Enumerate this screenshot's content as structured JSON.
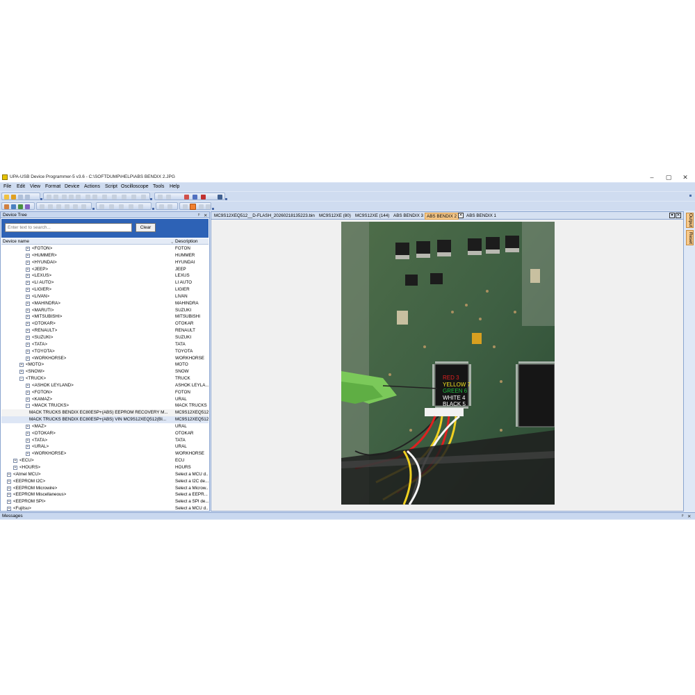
{
  "window": {
    "title": "UPA-USB Device Programmer-5 v3.6 - C:\\SOFTDUMP\\HELP\\ABS BENDIX 2.JPG",
    "minimize": "–",
    "maximize": "▢",
    "close": "✕"
  },
  "menu": [
    "File",
    "Edit",
    "View",
    "Format",
    "Device",
    "Actions",
    "Script",
    "Oscilloscope",
    "Tools",
    "Help"
  ],
  "device_tree": {
    "title": "Device Tree",
    "pin": "ᵖ",
    "close": "✕",
    "search_placeholder": "Enter text to search...",
    "clear_label": "Clear",
    "col_name": "Device name",
    "col_desc": "Description",
    "rows": [
      {
        "name": "<FOTON>",
        "desc": "FOTON",
        "indent": 3
      },
      {
        "name": "<HUMMER>",
        "desc": "HUMMER",
        "indent": 3
      },
      {
        "name": "<HYUNDAI>",
        "desc": "HYUNDAI",
        "indent": 3
      },
      {
        "name": "<JEEP>",
        "desc": "JEEP",
        "indent": 3
      },
      {
        "name": "<LEXUS>",
        "desc": "LEXUS",
        "indent": 3
      },
      {
        "name": "<LI AUTO>",
        "desc": "LI AUTO",
        "indent": 3
      },
      {
        "name": "<LIGIER>",
        "desc": "LIGIER",
        "indent": 3
      },
      {
        "name": "<LIVAN>",
        "desc": "LIVAN",
        "indent": 3
      },
      {
        "name": "<MAHINDRA>",
        "desc": "MAHINDRA",
        "indent": 3
      },
      {
        "name": "<MARUTI>",
        "desc": "SUZUKI",
        "indent": 3
      },
      {
        "name": "<MITSUBISHI>",
        "desc": "MITSUBISHI",
        "indent": 3
      },
      {
        "name": "<OTOKAR>",
        "desc": "OTOKAR",
        "indent": 3
      },
      {
        "name": "<RENAULT>",
        "desc": "RENAULT",
        "indent": 3
      },
      {
        "name": "<SUZUKI>",
        "desc": "SUZUKI",
        "indent": 3
      },
      {
        "name": "<TATA>",
        "desc": "TATA",
        "indent": 3
      },
      {
        "name": "<TOYOTA>",
        "desc": "TOYOTA",
        "indent": 3
      },
      {
        "name": "<WORKHORSE>",
        "desc": "WORKHORSE",
        "indent": 3
      },
      {
        "name": "<MOTO>",
        "desc": "MOTO",
        "indent": 2
      },
      {
        "name": "<SNOW>",
        "desc": "SNOW",
        "indent": 2
      },
      {
        "name": "<TRUCK>",
        "desc": "TRUCK",
        "indent": 2,
        "expanded": true
      },
      {
        "name": "<ASHOK LEYLAND>",
        "desc": "ASHOK LEYLA...",
        "indent": 3
      },
      {
        "name": "<FOTON>",
        "desc": "FOTON",
        "indent": 3
      },
      {
        "name": "<KAMAZ>",
        "desc": "URAL",
        "indent": 3
      },
      {
        "name": "<MACK TRUCKS>",
        "desc": "MACK TRUCKS",
        "indent": 3,
        "expanded": true
      },
      {
        "name": "MACK TRUCKS BENDIX EC80ESP+(ABS) EEPROM RECOVERY M...",
        "desc": "MC9S12XEQ512",
        "indent": 4,
        "leaf": true,
        "sel": 1
      },
      {
        "name": "MACK TRUCKS BENDIX EC80ESP+(ABS) VIN MC9S12XEQ512(BI...",
        "desc": "MC9S12XEQ512",
        "indent": 4,
        "leaf": true,
        "sel": 2
      },
      {
        "name": "<MAZ>",
        "desc": "URAL",
        "indent": 3
      },
      {
        "name": "<OTOKAR>",
        "desc": "OTOKAR",
        "indent": 3
      },
      {
        "name": "<TATA>",
        "desc": "TATA",
        "indent": 3
      },
      {
        "name": "<URAL>",
        "desc": "URAL",
        "indent": 3
      },
      {
        "name": "<WORKHORSE>",
        "desc": "WORKHORSE",
        "indent": 3
      },
      {
        "name": "<ECU>",
        "desc": "ECU",
        "indent": 1
      },
      {
        "name": "<HOURS>",
        "desc": "HOURS",
        "indent": 1
      },
      {
        "name": "<Atmel MCU>",
        "desc": "Select a MCU d...",
        "indent": 0
      },
      {
        "name": "<EEPROM I2C>",
        "desc": "Select a I2C de...",
        "indent": 0
      },
      {
        "name": "<EEPROM Microwire>",
        "desc": "Select a Microw...",
        "indent": 0
      },
      {
        "name": "<EEPROM Miscellaneous>",
        "desc": "Select a EEPR...",
        "indent": 0
      },
      {
        "name": "<EEPROM SPI>",
        "desc": "Select a SPI de...",
        "indent": 0
      },
      {
        "name": "<Fujitsu>",
        "desc": "Select a MCU d...",
        "indent": 0
      }
    ]
  },
  "tabs": [
    {
      "label": "MC9S12XEQ512__D-FLASH_20260218135223.bin",
      "active": false
    },
    {
      "label": "MC9S12XE (80)",
      "active": false
    },
    {
      "label": "MC9S12XE (144)",
      "active": false
    },
    {
      "label": "ABS BENDIX 3",
      "active": false
    },
    {
      "label": "ABS BENDIX 2",
      "active": true
    },
    {
      "label": "ABS BENDIX 1",
      "active": false
    }
  ],
  "tab_close": "✕",
  "photo_labels": [
    {
      "text": "RED 3",
      "color": "#e02020"
    },
    {
      "text": "YELLOW 7",
      "color": "#f0e020"
    },
    {
      "text": "GREEN 6",
      "color": "#20c040"
    },
    {
      "text": "WHITE 4",
      "color": "#ffffff"
    },
    {
      "text": "BLACK 5",
      "color": "#ffffff"
    }
  ],
  "side_tabs": [
    "Output",
    "Reset"
  ],
  "messages": {
    "title": "Messages",
    "pin": "ᵖ",
    "close": "✕"
  }
}
